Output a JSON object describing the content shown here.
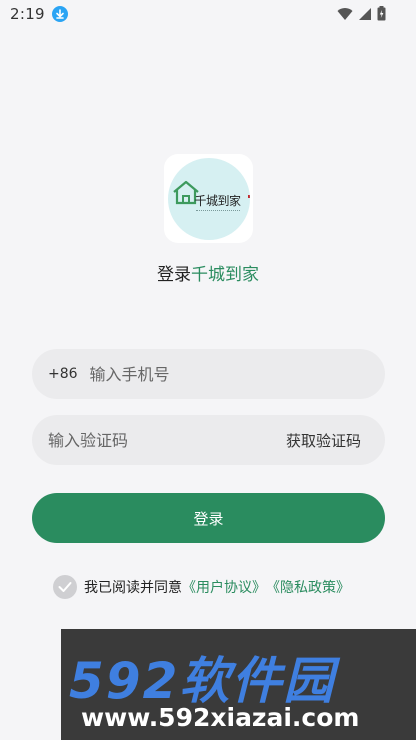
{
  "status_bar": {
    "time": "2:19",
    "icons": [
      "download-icon",
      "wifi-icon",
      "signal-icon",
      "battery-icon"
    ]
  },
  "logo": {
    "text": "千城到家",
    "icon": "house-icon"
  },
  "title": {
    "prefix": "登录",
    "brand": "千城到家"
  },
  "phone_field": {
    "prefix": "+86",
    "placeholder": "输入手机号",
    "value": ""
  },
  "code_field": {
    "placeholder": "输入验证码",
    "value": "",
    "get_code_label": "获取验证码"
  },
  "login_button": {
    "label": "登录"
  },
  "agreement": {
    "text": "我已阅读并同意",
    "user_agreement": "《用户协议》",
    "privacy_policy": "《隐私政策》",
    "checked": true
  },
  "watermark": {
    "big": "592软件园",
    "url": "www.592xiazai.com"
  },
  "colors": {
    "accent": "#2a8c5f",
    "background": "#f5f5f7",
    "field_bg": "#ebebed"
  }
}
